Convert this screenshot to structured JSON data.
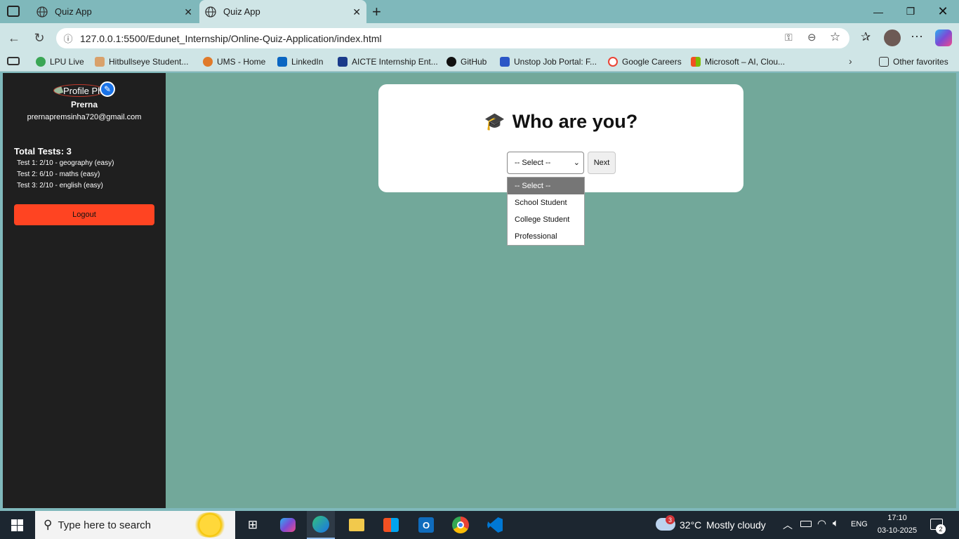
{
  "browser": {
    "tabs": [
      {
        "title": "Quiz App"
      },
      {
        "title": "Quiz App"
      }
    ],
    "url": "127.0.0.1:5500/Edunet_Internship/Online-Quiz-Application/index.html",
    "favorites": [
      {
        "label": "LPU Live",
        "color": "#3aa655"
      },
      {
        "label": "Hitbullseye Student...",
        "color": "#d9a16b"
      },
      {
        "label": "UMS - Home",
        "color": "#e07a2a"
      },
      {
        "label": "LinkedIn",
        "color": "#0a66c2"
      },
      {
        "label": "AICTE Internship Ent...",
        "color": "#1a3a8a"
      },
      {
        "label": "GitHub",
        "color": "#111111"
      },
      {
        "label": "Unstop Job Portal: F...",
        "color": "#2b56c6"
      },
      {
        "label": "Google Careers",
        "color": "#ea4335"
      },
      {
        "label": "Microsoft – AI, Clou...",
        "color": "#f25022"
      }
    ],
    "other_favorites": "Other favorites"
  },
  "sidebar": {
    "profile_alt": "Profile Ph",
    "name": "Prerna",
    "email": "prernapremsinha720@gmail.com",
    "total_tests": "Total Tests: 3",
    "tests": [
      "Test 1: 2/10 - geography (easy)",
      "Test 2: 6/10 - maths (easy)",
      "Test 3: 2/10 - english (easy)"
    ],
    "logout": "Logout"
  },
  "card": {
    "emoji": "🎓",
    "heading": "Who are you?",
    "select_value": "-- Select --",
    "next": "Next",
    "options": [
      "-- Select --",
      "School Student",
      "College Student",
      "Professional"
    ]
  },
  "taskbar": {
    "search_placeholder": "Type here to search",
    "weather_temp": "32°C",
    "weather_text": "Mostly cloudy",
    "weather_badge": "3",
    "lang": "ENG",
    "time": "17:10",
    "date": "03-10-2025",
    "notif_count": "2"
  },
  "colors": {
    "page_bg": "#72a89a",
    "sidebar_bg": "#1f1f1f",
    "logout_bg": "#ff4422",
    "accent": "#1a73e8"
  }
}
